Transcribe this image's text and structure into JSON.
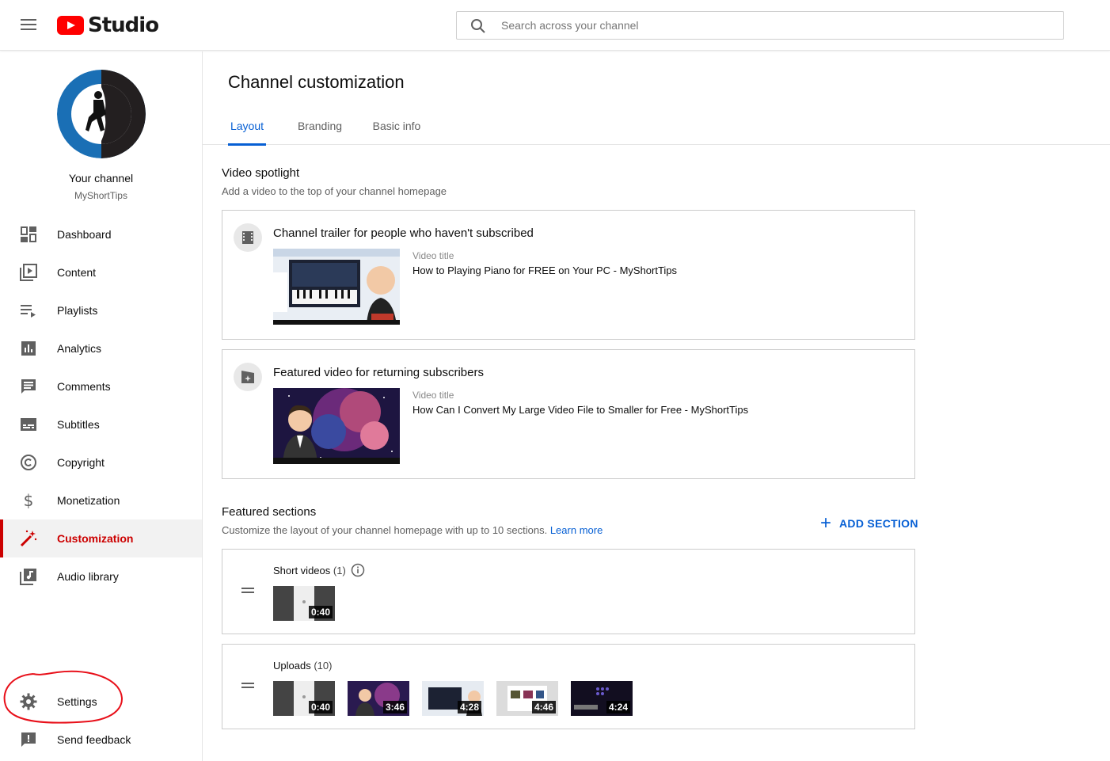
{
  "header": {
    "logo_text": "Studio",
    "search_placeholder": "Search across your channel"
  },
  "sidebar": {
    "channel_title": "Your channel",
    "channel_handle": "MyShortTips",
    "items": [
      {
        "label": "Dashboard",
        "icon": "dashboard-icon"
      },
      {
        "label": "Content",
        "icon": "content-icon"
      },
      {
        "label": "Playlists",
        "icon": "playlists-icon"
      },
      {
        "label": "Analytics",
        "icon": "analytics-icon"
      },
      {
        "label": "Comments",
        "icon": "comments-icon"
      },
      {
        "label": "Subtitles",
        "icon": "subtitles-icon"
      },
      {
        "label": "Copyright",
        "icon": "copyright-icon"
      },
      {
        "label": "Monetization",
        "icon": "dollar-icon"
      },
      {
        "label": "Customization",
        "icon": "magic-wand-icon",
        "active": true
      },
      {
        "label": "Audio library",
        "icon": "audio-library-icon"
      }
    ],
    "bottom_items": [
      {
        "label": "Settings",
        "icon": "gear-icon"
      },
      {
        "label": "Send feedback",
        "icon": "feedback-icon"
      }
    ]
  },
  "main": {
    "title": "Channel customization",
    "tabs": [
      {
        "label": "Layout",
        "active": true
      },
      {
        "label": "Branding"
      },
      {
        "label": "Basic info"
      }
    ],
    "spotlight": {
      "title": "Video spotlight",
      "subtitle": "Add a video to the top of your channel homepage",
      "trailer": {
        "title": "Channel trailer for people who haven't subscribed",
        "video_title_label": "Video title",
        "video_title": "How to Playing Piano for FREE on Your PC - MyShortTips"
      },
      "featured": {
        "title": "Featured video for returning subscribers",
        "video_title_label": "Video title",
        "video_title": "How Can I Convert My Large Video File to Smaller for Free - MyShortTips"
      }
    },
    "featured_sections": {
      "title": "Featured sections",
      "subtitle": "Customize the layout of your channel homepage with up to 10 sections.",
      "learn_more": "Learn more",
      "add_section": "ADD SECTION",
      "sections": [
        {
          "title": "Short videos",
          "count": "(1)",
          "durations": [
            "0:40"
          ]
        },
        {
          "title": "Uploads",
          "count": "(10)",
          "durations": [
            "0:40",
            "3:46",
            "4:28",
            "4:46",
            "4:24"
          ]
        }
      ]
    }
  },
  "colors": {
    "accent_blue": "#065fd4",
    "active_red": "#cc0000",
    "youtube_red": "#ff0000"
  }
}
